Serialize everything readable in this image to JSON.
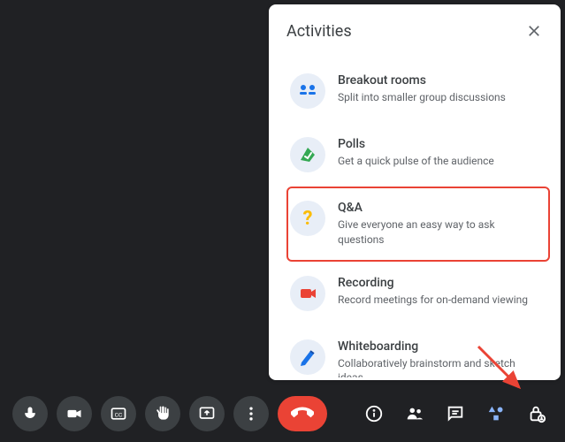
{
  "panel": {
    "title": "Activities",
    "close_tooltip": "Close"
  },
  "activities": [
    {
      "key": "breakout",
      "title": "Breakout rooms",
      "desc": "Split into smaller group discussions",
      "highlight": false
    },
    {
      "key": "polls",
      "title": "Polls",
      "desc": "Get a quick pulse of the audience",
      "highlight": false
    },
    {
      "key": "qa",
      "title": "Q&A",
      "desc": "Give everyone an easy way to ask questions",
      "highlight": true
    },
    {
      "key": "recording",
      "title": "Recording",
      "desc": "Record meetings for on-demand viewing",
      "highlight": false
    },
    {
      "key": "whiteboard",
      "title": "Whiteboarding",
      "desc": "Collaboratively brainstorm and sketch ideas",
      "highlight": false
    }
  ],
  "controls": {
    "mic": "Microphone",
    "cam": "Camera",
    "cc": "Captions",
    "hand": "Raise hand",
    "present": "Present now",
    "more": "More options",
    "end": "Leave call",
    "info": "Meeting details",
    "people": "People",
    "chat": "Chat",
    "activities": "Activities",
    "host": "Host controls"
  }
}
